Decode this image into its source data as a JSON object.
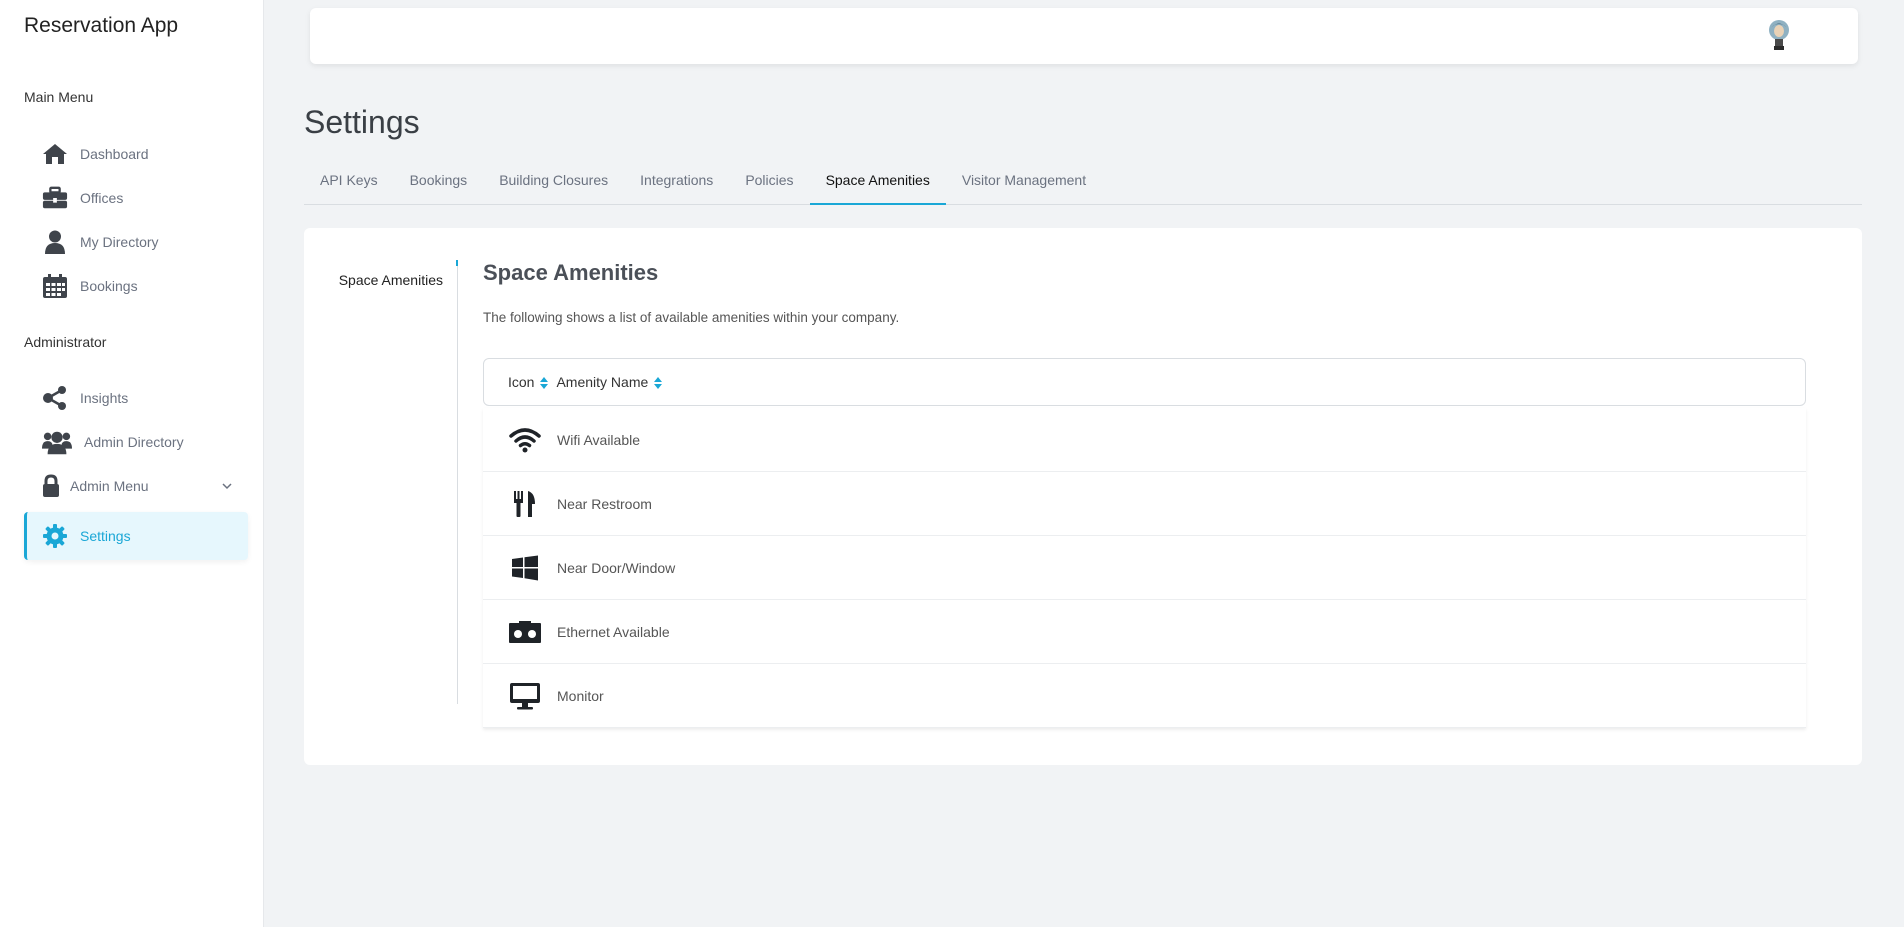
{
  "app": {
    "title": "Reservation App"
  },
  "sidebar": {
    "main_menu_title": "Main Menu",
    "admin_title": "Administrator",
    "main_items": [
      {
        "label": "Dashboard",
        "icon": "home-icon"
      },
      {
        "label": "Offices",
        "icon": "briefcase-icon"
      },
      {
        "label": "My Directory",
        "icon": "user-icon"
      },
      {
        "label": "Bookings",
        "icon": "calendar-icon"
      }
    ],
    "admin_items": [
      {
        "label": "Insights",
        "icon": "share-icon"
      },
      {
        "label": "Admin Directory",
        "icon": "users-icon"
      },
      {
        "label": "Admin Menu",
        "icon": "lock-icon"
      },
      {
        "label": "Settings",
        "icon": "gear-icon"
      }
    ],
    "active_item": "Settings",
    "accent_color": "#1aa7d6"
  },
  "page": {
    "title": "Settings",
    "tabs": [
      {
        "label": "API Keys"
      },
      {
        "label": "Bookings"
      },
      {
        "label": "Building Closures"
      },
      {
        "label": "Integrations"
      },
      {
        "label": "Policies"
      },
      {
        "label": "Space Amenities"
      },
      {
        "label": "Visitor Management"
      }
    ],
    "active_tab": "Space Amenities"
  },
  "content": {
    "side_tab": "Space Amenities",
    "heading": "Space Amenities",
    "description": "The following shows a list of available amenities within your company.",
    "columns": [
      "Icon",
      "Amenity Name"
    ],
    "rows": [
      {
        "icon": "wifi-icon",
        "name": "Wifi Available"
      },
      {
        "icon": "utensils-icon",
        "name": "Near Restroom"
      },
      {
        "icon": "windows-icon",
        "name": "Near Door/Window"
      },
      {
        "icon": "ethernet-icon",
        "name": "Ethernet Available"
      },
      {
        "icon": "monitor-icon",
        "name": "Monitor"
      }
    ]
  }
}
